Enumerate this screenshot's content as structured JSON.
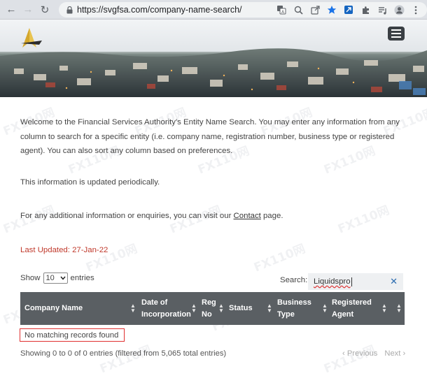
{
  "browser": {
    "url": "https://svgfsa.com/company-name-search/",
    "icons": [
      "back-icon",
      "forward-icon",
      "reload-icon",
      "lock-icon",
      "translate-icon",
      "zoom-icon",
      "share-icon",
      "star-icon",
      "extension-icon",
      "puzzle-icon",
      "media-icon",
      "profile-icon",
      "more-icon"
    ]
  },
  "intro": {
    "welcome": "Welcome to the Financial Services Authority's Entity Name Search. You may enter any information from any column to search for a specific entity (i.e. company name, registration number, business type or registered agent). You can also sort any column based on preferences.",
    "periodic": "This information is updated periodically.",
    "contact_prefix": "For any additional information or enquiries, you can visit our ",
    "contact_link": "Contact",
    "contact_suffix": " page.",
    "last_updated": "Last Updated:  27-Jan-22"
  },
  "controls": {
    "show_label": "Show",
    "entries_value": "10",
    "entries_label": "entries",
    "search_label": "Search:",
    "search_value": "Liquidspro"
  },
  "table": {
    "columns": [
      {
        "line1": "Company Name",
        "line2": ""
      },
      {
        "line1": "Date of",
        "line2": "Incorporation"
      },
      {
        "line1": "Reg",
        "line2": "No"
      },
      {
        "line1": "Status",
        "line2": ""
      },
      {
        "line1": "Business",
        "line2": "Type"
      },
      {
        "line1": "Registered",
        "line2": "Agent"
      }
    ],
    "empty_message": "No matching records found",
    "info": "Showing 0 to 0 of 0 entries (filtered from 5,065 total entries)",
    "previous": "Previous",
    "next": "Next"
  },
  "colors": {
    "header_bg": "#5a5f63",
    "last_updated": "#c0392b",
    "highlight_border": "#e03030"
  },
  "watermark": "FX110网"
}
